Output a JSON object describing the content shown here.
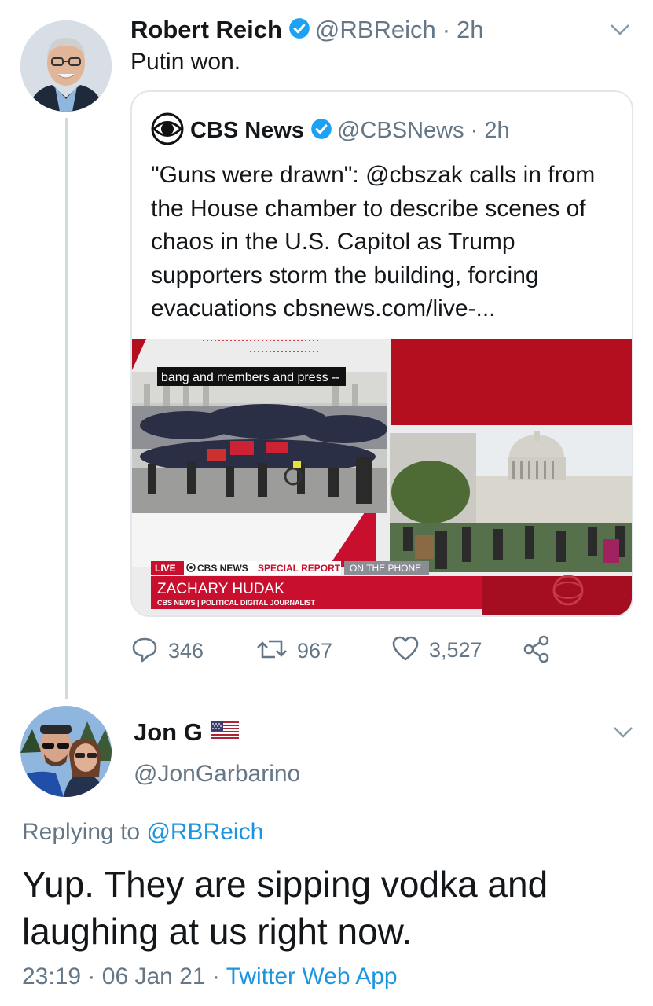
{
  "original_tweet": {
    "author_name": "Robert Reich",
    "author_handle": "@RBReich",
    "separator": "·",
    "time": "2h",
    "text": "Putin won."
  },
  "quoted_tweet": {
    "author_name": "CBS News",
    "author_handle": "@CBSNews",
    "separator": "·",
    "time": "2h",
    "text": "\"Guns were drawn\": @cbszak calls in from the House chamber to describe scenes of chaos in the U.S. Capitol as Trump supporters storm the building, forcing evacuations cbsnews.com/live-...",
    "media": {
      "caption": "bang and members and press --",
      "live_label": "LIVE",
      "network_label": "CBS NEWS",
      "special_label": "SPECIAL REPORT",
      "phone_label": "ON THE PHONE",
      "person_name": "ZACHARY HUDAK",
      "person_title": "CBS NEWS | POLITICAL DIGITAL JOURNALIST"
    }
  },
  "actions": {
    "replies": "346",
    "retweets": "967",
    "likes": "3,527"
  },
  "reply_tweet": {
    "author_name": "Jon G",
    "flag_icon": "us-flag-icon",
    "author_handle": "@JonGarbarino",
    "replying_prefix": "Replying to",
    "replying_to": "@RBReich",
    "text": "Yup. They are sipping vodka and laughing at us right now.",
    "time": "23:19",
    "separator": "·",
    "date": "06 Jan 21",
    "source": "Twitter Web App"
  },
  "colors": {
    "verified": "#1da1f2",
    "link": "#1b95e0",
    "muted": "#657786",
    "cbs_red": "#c8102e"
  }
}
